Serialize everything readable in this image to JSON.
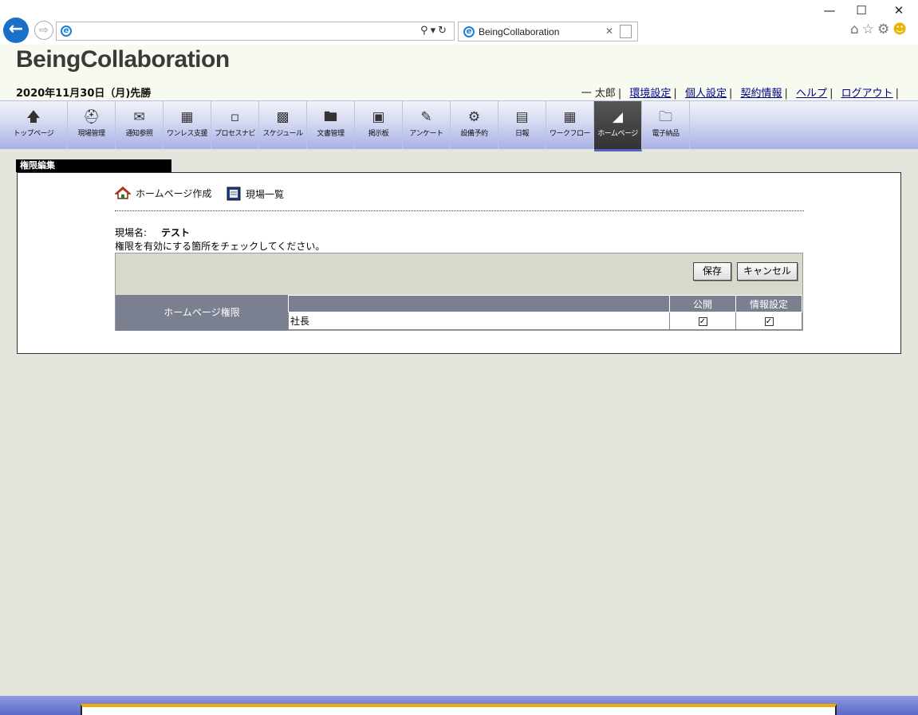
{
  "browser": {
    "address_value": "",
    "tab_title": "BeingCollaboration",
    "window_controls": [
      "minimize-icon",
      "maximize-icon",
      "close-icon"
    ],
    "toolbar_icons": [
      "home-icon",
      "star-icon",
      "gear-icon",
      "smiley-icon"
    ]
  },
  "header": {
    "brand": "BeingCollaboration",
    "date_line": "2020年11月30日（月)先勝",
    "user_name": "一 太郎",
    "links": [
      "環境設定",
      "個人設定",
      "契約情報",
      "ヘルプ",
      "ログアウト"
    ]
  },
  "nav": {
    "items": [
      {
        "label": "トップページ",
        "icon": "up-arrow-icon"
      },
      {
        "label": "現場管理",
        "icon": "helmet-icon"
      },
      {
        "label": "通知参照",
        "icon": "envelope-icon"
      },
      {
        "label": "ワンレス支援",
        "icon": "calendar-day-icon"
      },
      {
        "label": "プロセスナビ",
        "icon": "clipboard-icon"
      },
      {
        "label": "スケジュール",
        "icon": "calendar-icon"
      },
      {
        "label": "文書管理",
        "icon": "folder-icon"
      },
      {
        "label": "掲示板",
        "icon": "board-icon"
      },
      {
        "label": "アンケート",
        "icon": "pencil-icon"
      },
      {
        "label": "設備予約",
        "icon": "crane-icon"
      },
      {
        "label": "日報",
        "icon": "document-icon"
      },
      {
        "label": "ワークフロー",
        "icon": "grid-icon"
      },
      {
        "label": "ホームページ",
        "icon": "triangle-ruler-icon",
        "active": true
      },
      {
        "label": "電子納品",
        "icon": "folder-gear-icon"
      }
    ]
  },
  "section": {
    "title": "権限編集",
    "links": {
      "homepage_create": "ホームページ作成",
      "site_list": "現場一覧"
    },
    "site_name_label": "現場名:",
    "site_name_value": "テスト",
    "instruction": "権限を有効にする箇所をチェックしてください。",
    "buttons": {
      "save": "保存",
      "cancel": "キャンセル"
    },
    "permission_label": "ホームページ権限",
    "table": {
      "columns": [
        "",
        "公開",
        "情報設定"
      ],
      "rows": [
        {
          "name": "社長",
          "public": true,
          "info_settings": true
        }
      ]
    }
  }
}
